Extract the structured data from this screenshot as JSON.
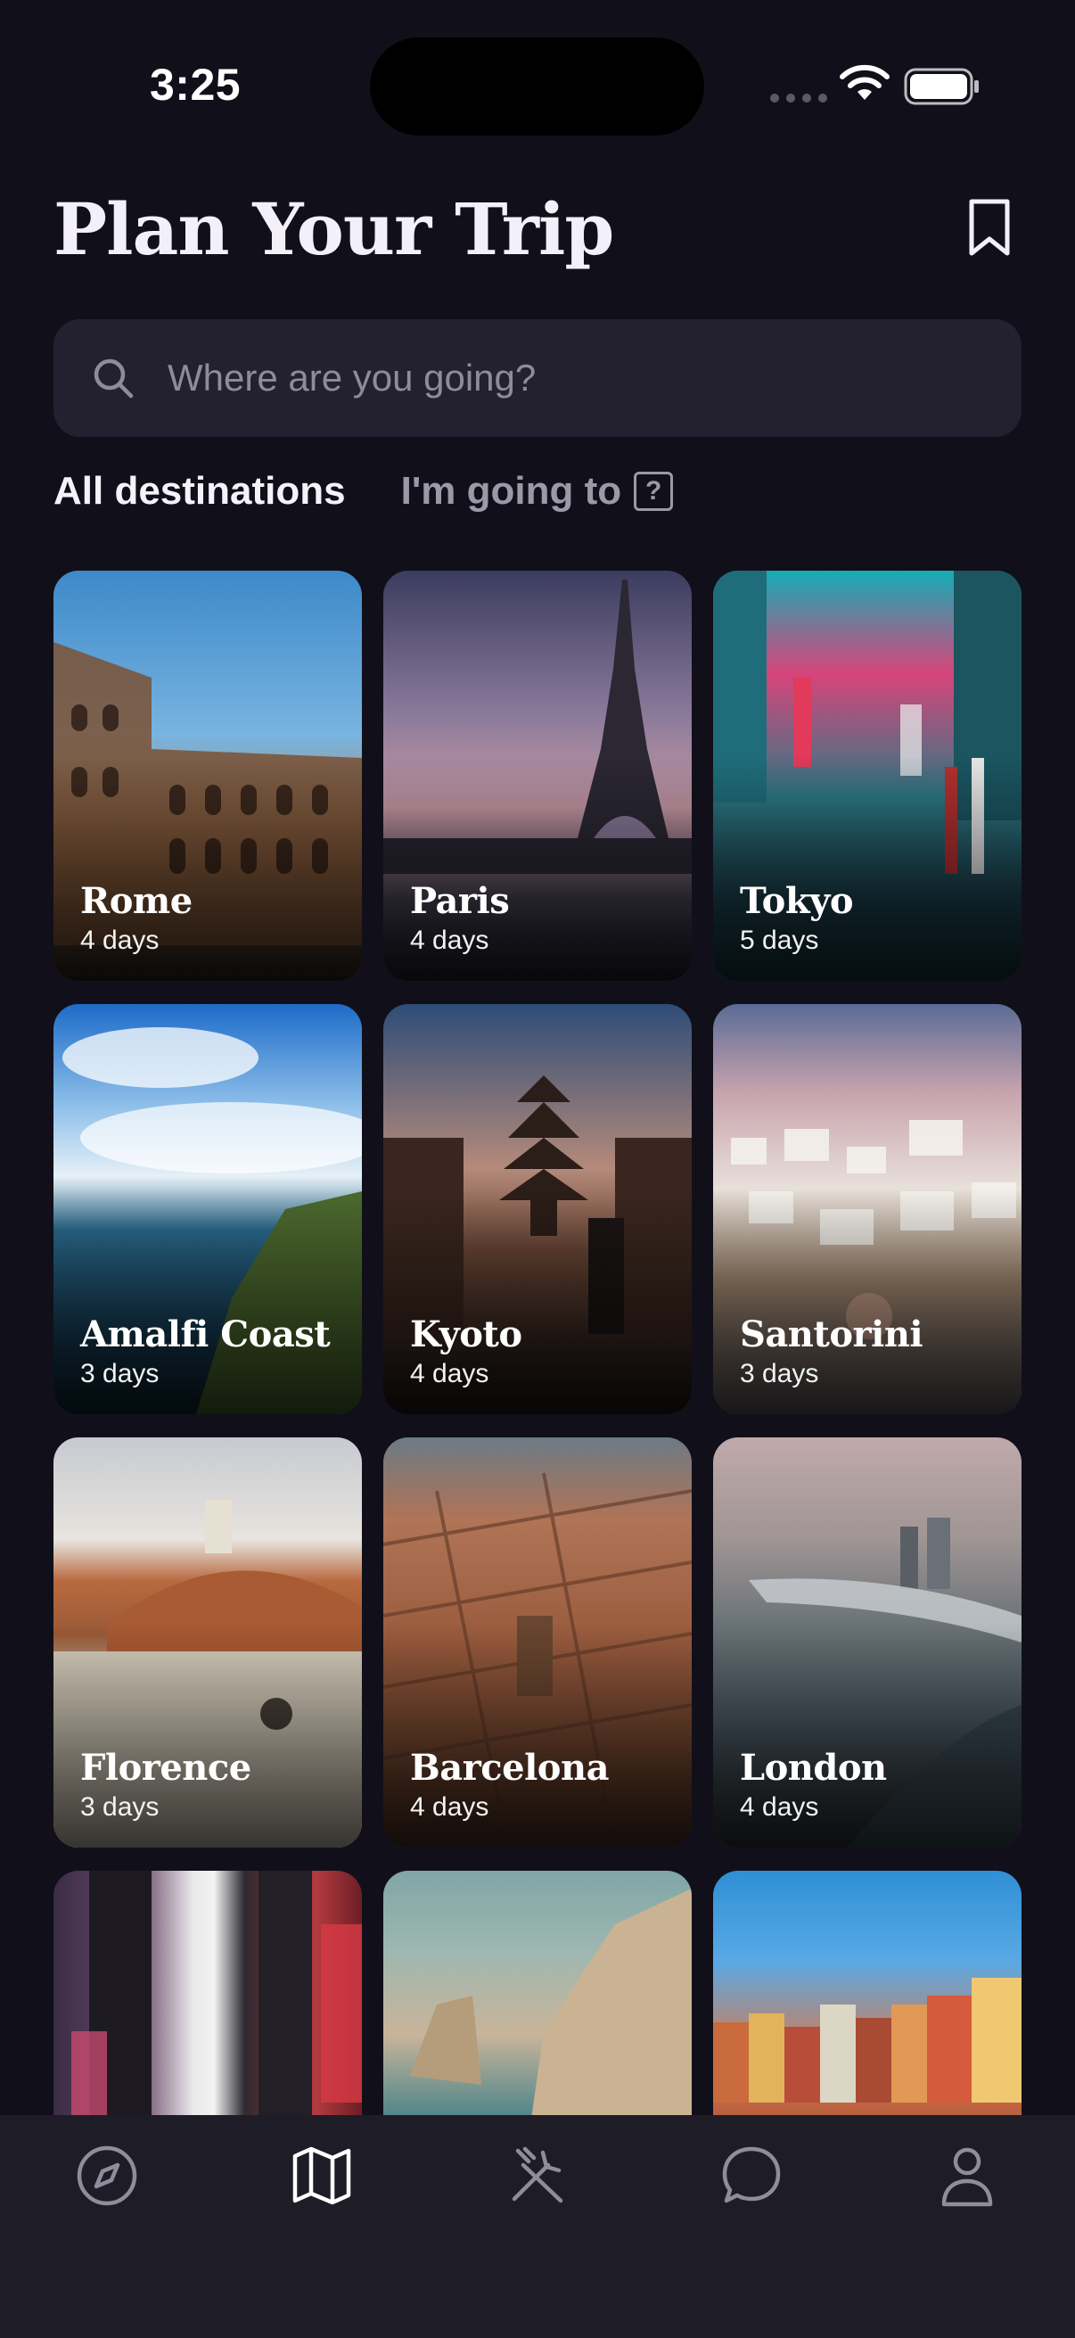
{
  "status_bar": {
    "time": "3:25"
  },
  "header": {
    "title": "Plan Your Trip"
  },
  "search": {
    "placeholder": "Where are you going?"
  },
  "tabs": {
    "all_label": "All destinations",
    "going_label": "I'm going to",
    "help_glyph": "?"
  },
  "destinations": [
    {
      "name": "Rome",
      "days": "4 days"
    },
    {
      "name": "Paris",
      "days": "4 days"
    },
    {
      "name": "Tokyo",
      "days": "5 days"
    },
    {
      "name": "Amalfi Coast",
      "days": "3 days"
    },
    {
      "name": "Kyoto",
      "days": "4 days"
    },
    {
      "name": "Santorini",
      "days": "3 days"
    },
    {
      "name": "Florence",
      "days": "3 days"
    },
    {
      "name": "Barcelona",
      "days": "4 days"
    },
    {
      "name": "London",
      "days": "4 days"
    }
  ],
  "nav": {
    "items": [
      "compass-icon",
      "map-icon",
      "utensils-crossed-icon",
      "chat-bubble-icon",
      "profile-icon"
    ],
    "active": "map-icon"
  },
  "colors": {
    "background": "#11101a",
    "search_bg": "#23212f",
    "nav_bg": "#1e1d27",
    "text_primary": "#f3f0fa",
    "text_muted": "#9b99a8"
  }
}
